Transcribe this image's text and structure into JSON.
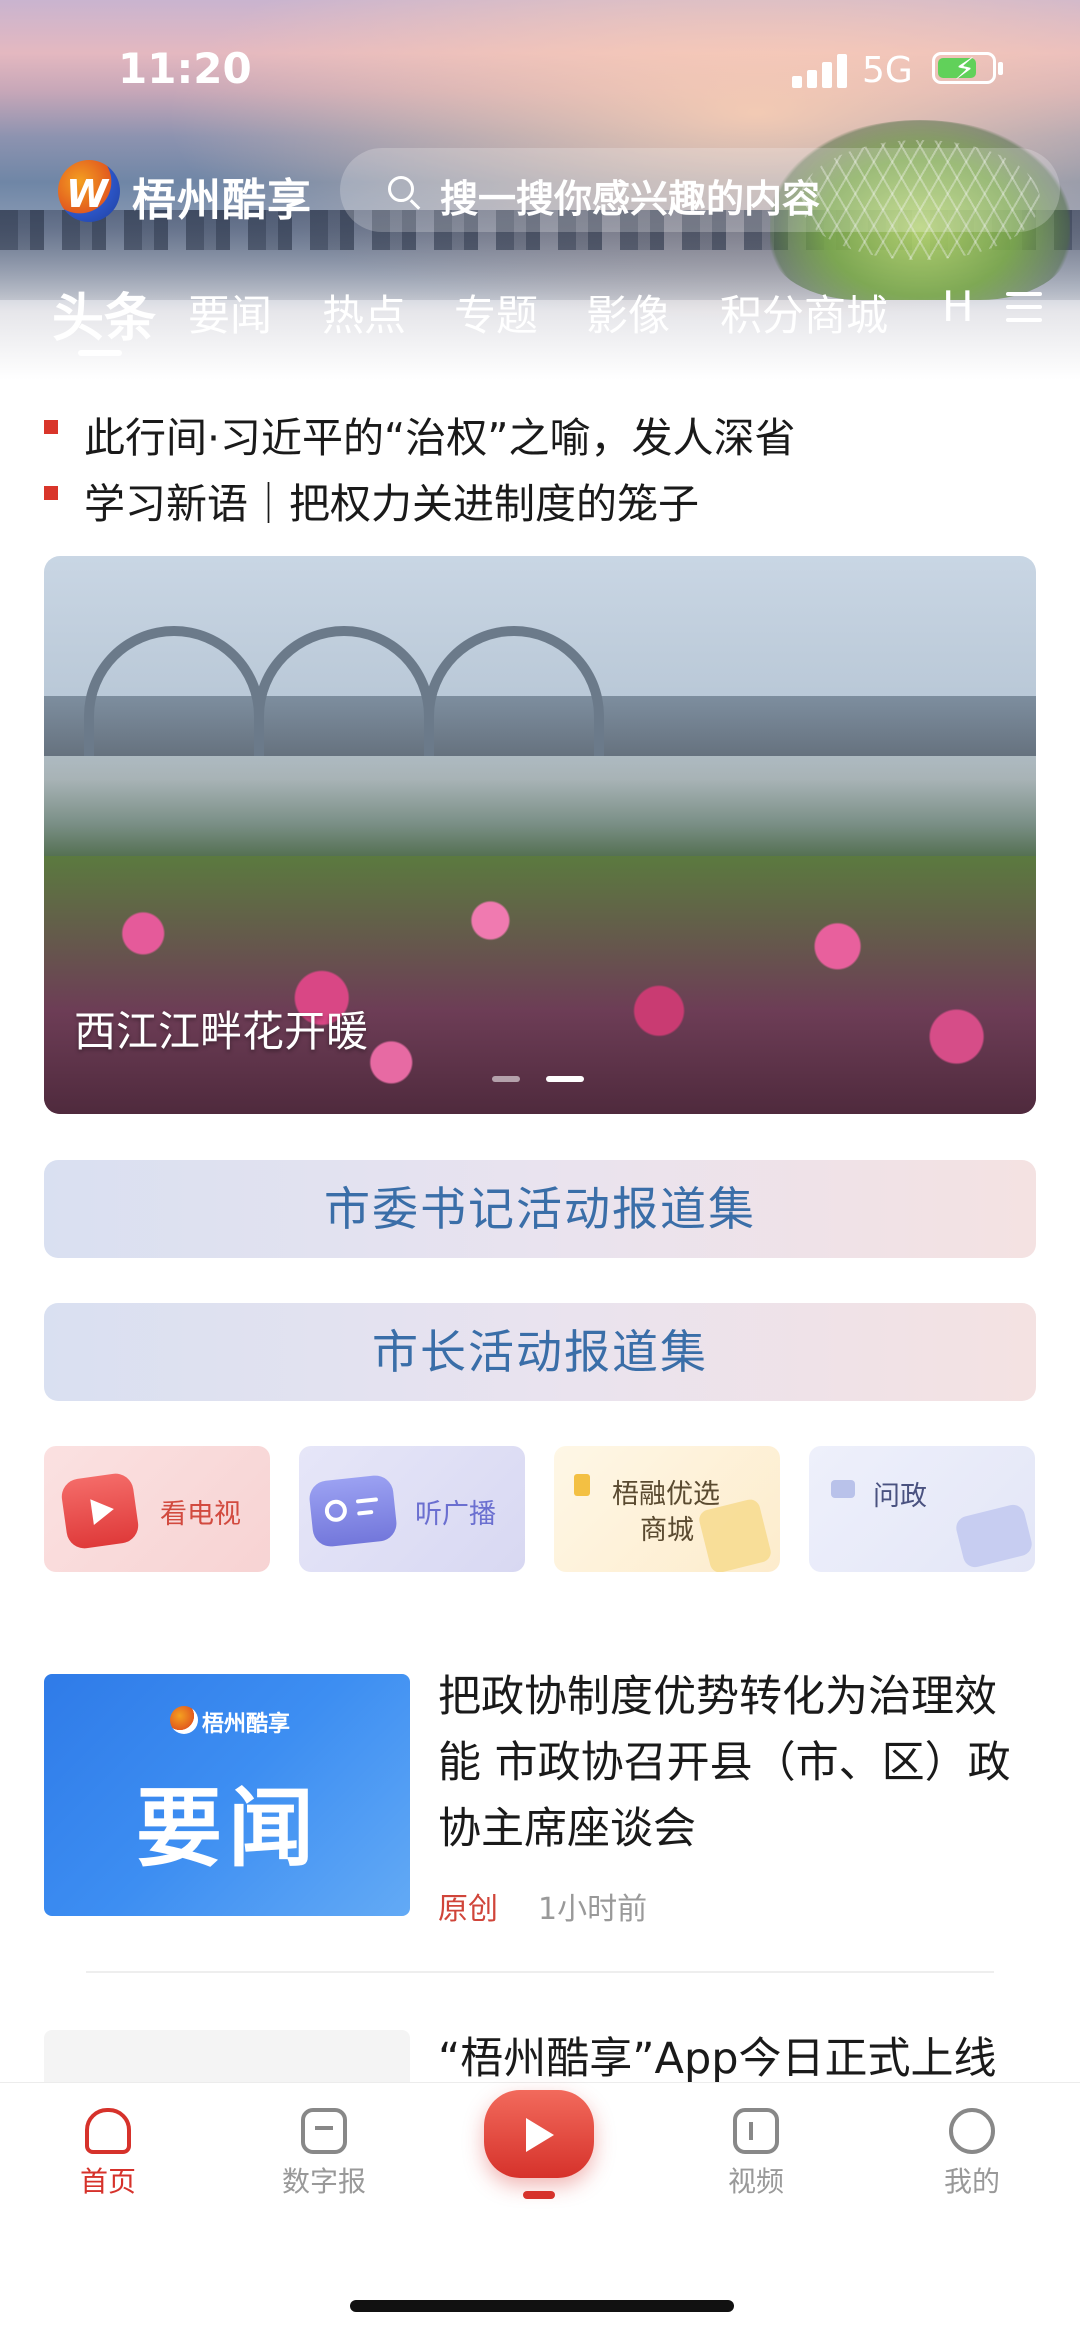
{
  "status_bar": {
    "time": "11:20",
    "network": "5G"
  },
  "header": {
    "app_name": "梧州酷享",
    "search_placeholder": "搜一搜你感兴趣的内容"
  },
  "tabs": [
    {
      "label": "头条",
      "active": true
    },
    {
      "label": "要闻"
    },
    {
      "label": "热点"
    },
    {
      "label": "专题"
    },
    {
      "label": "影像"
    },
    {
      "label": "积分商城"
    },
    {
      "label": "H"
    }
  ],
  "headlines": [
    "此行间·习近平的“治权”之喻，发人深省",
    "学习新语｜把权力关进制度的笼子"
  ],
  "banner": {
    "caption": "西江江畔花开暖",
    "active_slide": 2,
    "slide_count": 2
  },
  "collections": [
    {
      "label": "市委书记活动报道集"
    },
    {
      "label": "市长活动报道集"
    }
  ],
  "services": [
    {
      "label": "看电视",
      "icon": "tv-icon"
    },
    {
      "label": "听广播",
      "icon": "radio-icon"
    },
    {
      "label_line1": "梧融优选",
      "label_line2": "商城",
      "icon": "shop-icon"
    },
    {
      "label": "问政",
      "icon": "chat-icon"
    }
  ],
  "news": [
    {
      "thumb_brand": "梧州酷享",
      "thumb_text": "要闻",
      "title": "把政协制度优势转化为治理效能 市政协召开县（市、区）政协主席座谈会",
      "tag": "原创",
      "time": "1小时前"
    },
    {
      "title": "“梧州酷享”App今日正式上线"
    }
  ],
  "bottom_nav": [
    {
      "label": "首页",
      "active": true
    },
    {
      "label": "数字报"
    },
    {
      "label": ""
    },
    {
      "label": "视频"
    },
    {
      "label": "我的"
    }
  ],
  "colors": {
    "accent": "#d6322b",
    "link_blue": "#3a6ea8",
    "tag_red": "#d0453a"
  }
}
